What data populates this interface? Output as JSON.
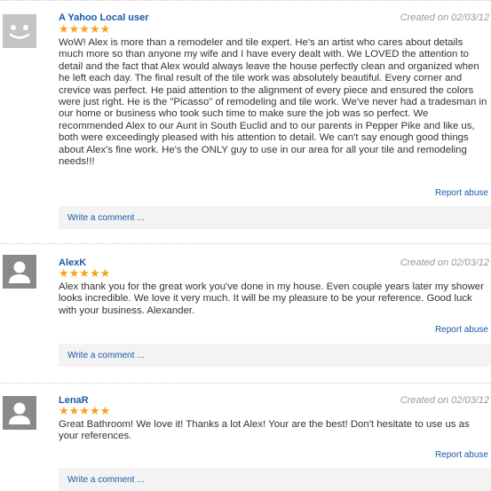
{
  "reviews": [
    {
      "author": "A Yahoo Local user",
      "date": "Created on 02/03/12",
      "stars": "★★★★★",
      "avatar_icon": "smiley-face-avatar-icon",
      "text": "WoW! Alex is more than a remodeler and tile expert. He's an artist who cares about details much more so than anyone my wife and I have every dealt with. We LOVED the attention to detail and the fact that Alex would always leave the house perfectly clean and organized when he left each day. The final result of the tile work was absolutely beautiful. Every corner and crevice was perfect. He paid attention to the alignment of every piece and ensured the colors were just right. He is the \"Picasso\" of remodeling and tile work. We've never had a tradesman in our home or business who took such time to make sure the job was so perfect. We recommended Alex to our Aunt in South Euclid and to our parents in Pepper Pike and like us, both were exceedingly pleased with his attention to detail. We can't say enough good things about Alex's fine work. He's the ONLY guy to use in our area for all your tile and remodeling needs!!!",
      "report": "Report abuse",
      "comment": "Write a comment ..."
    },
    {
      "author": "AlexK",
      "date": "Created on 02/03/12",
      "stars": "★★★★★",
      "avatar_icon": "person-silhouette-avatar-icon",
      "text": "Alex thank you for the great work you've done in my house. Even couple years later my shower looks incredible. We love it very much. It will be my pleasure to be your reference. Good luck with your business. Alexander.",
      "report": "Report abuse",
      "comment": "Write a comment ..."
    },
    {
      "author": "LenaR",
      "date": "Created on 02/03/12",
      "stars": "★★★★★",
      "avatar_icon": "person-silhouette-avatar-icon",
      "text": "Great Bathroom! We love it! Thanks a lot Alex! Your are the best! Don't hesitate to use us as your references.",
      "report": "Report abuse",
      "comment": "Write a comment ..."
    }
  ],
  "colors": {
    "link": "#1a5aa6",
    "star": "#f7a21b",
    "date": "#9a9a9a",
    "comment_bar": "#f3f3f3"
  }
}
